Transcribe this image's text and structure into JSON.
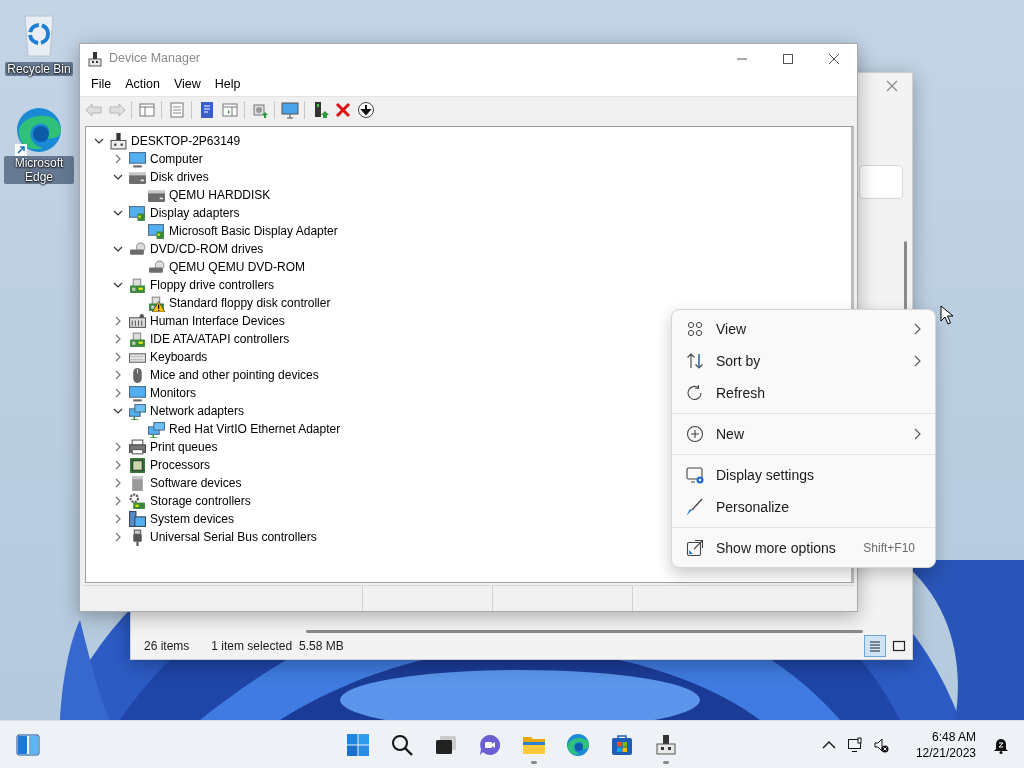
{
  "desktop_icons": [
    {
      "kind": "recycle-bin",
      "label": "Recycle Bin"
    },
    {
      "kind": "edge",
      "label": "Microsoft Edge"
    }
  ],
  "explorer_window": {
    "status_bar": {
      "item_count": "26 items",
      "selection": "1 item selected",
      "size": "5.58 MB"
    },
    "view_buttons": [
      {
        "kind": "details",
        "selected": true
      },
      {
        "kind": "tiles",
        "selected": false
      }
    ]
  },
  "device_manager": {
    "title": "Device Manager",
    "menu": [
      "File",
      "Action",
      "View",
      "Help"
    ],
    "toolbar": [
      {
        "kind": "back",
        "disabled": true
      },
      {
        "kind": "forward",
        "disabled": true
      },
      {
        "kind": "separator"
      },
      {
        "kind": "console-tree",
        "disabled": false
      },
      {
        "kind": "separator"
      },
      {
        "kind": "properties",
        "disabled": false
      },
      {
        "kind": "separator"
      },
      {
        "kind": "help",
        "disabled": false
      },
      {
        "kind": "action-pane",
        "disabled": false
      },
      {
        "kind": "separator"
      },
      {
        "kind": "scan",
        "disabled": false
      },
      {
        "kind": "separator"
      },
      {
        "kind": "monitor",
        "disabled": false
      },
      {
        "kind": "separator"
      },
      {
        "kind": "update",
        "disabled": false
      },
      {
        "kind": "uninstall",
        "disabled": false
      },
      {
        "kind": "disable",
        "disabled": false
      }
    ],
    "tree": {
      "label": "DESKTOP-2P63149",
      "kind": "computer",
      "expanded": true,
      "warning": false,
      "children": [
        {
          "label": "Computer",
          "kind": "monitor",
          "expanded": false,
          "warning": false
        },
        {
          "label": "Disk drives",
          "kind": "disk",
          "expanded": true,
          "warning": false,
          "children": [
            {
              "label": "QEMU HARDDISK",
              "kind": "disk",
              "warning": false
            }
          ]
        },
        {
          "label": "Display adapters",
          "kind": "display",
          "expanded": true,
          "warning": false,
          "children": [
            {
              "label": "Microsoft Basic Display Adapter",
              "kind": "display",
              "warning": false
            }
          ]
        },
        {
          "label": "DVD/CD-ROM drives",
          "kind": "dvd",
          "expanded": true,
          "warning": false,
          "children": [
            {
              "label": "QEMU QEMU DVD-ROM",
              "kind": "dvd",
              "warning": false
            }
          ]
        },
        {
          "label": "Floppy drive controllers",
          "kind": "board",
          "expanded": true,
          "warning": false,
          "children": [
            {
              "label": "Standard floppy disk controller",
              "kind": "board",
              "warning": true
            }
          ]
        },
        {
          "label": "Human Interface Devices",
          "kind": "hid",
          "expanded": false,
          "warning": false
        },
        {
          "label": "IDE ATA/ATAPI controllers",
          "kind": "board",
          "expanded": false,
          "warning": false
        },
        {
          "label": "Keyboards",
          "kind": "keyboard",
          "expanded": false,
          "warning": false
        },
        {
          "label": "Mice and other pointing devices",
          "kind": "mouse",
          "expanded": false,
          "warning": false
        },
        {
          "label": "Monitors",
          "kind": "monitor",
          "expanded": false,
          "warning": false
        },
        {
          "label": "Network adapters",
          "kind": "network",
          "expanded": true,
          "warning": false,
          "children": [
            {
              "label": "Red Hat VirtIO Ethernet Adapter",
              "kind": "network",
              "warning": false
            }
          ]
        },
        {
          "label": "Print queues",
          "kind": "printer",
          "expanded": false,
          "warning": false
        },
        {
          "label": "Processors",
          "kind": "processor",
          "expanded": false,
          "warning": false
        },
        {
          "label": "Software devices",
          "kind": "software",
          "expanded": false,
          "warning": false
        },
        {
          "label": "Storage controllers",
          "kind": "storage",
          "expanded": false,
          "warning": false
        },
        {
          "label": "System devices",
          "kind": "system",
          "expanded": false,
          "warning": false
        },
        {
          "label": "Universal Serial Bus controllers",
          "kind": "usb",
          "expanded": false,
          "warning": false
        }
      ]
    }
  },
  "context_menu": {
    "items": [
      {
        "kind": "view",
        "label": "View",
        "submenu": true
      },
      {
        "kind": "sort",
        "label": "Sort by",
        "submenu": true
      },
      {
        "kind": "refresh",
        "label": "Refresh",
        "submenu": false
      },
      {
        "kind": "separator"
      },
      {
        "kind": "new",
        "label": "New",
        "submenu": true
      },
      {
        "kind": "separator"
      },
      {
        "kind": "display",
        "label": "Display settings",
        "submenu": false
      },
      {
        "kind": "personalize",
        "label": "Personalize",
        "submenu": false
      },
      {
        "kind": "separator"
      },
      {
        "kind": "more",
        "label": "Show more options",
        "submenu": false,
        "shortcut": "Shift+F10"
      }
    ]
  },
  "taskbar": {
    "widgets": {
      "kind": "widgets"
    },
    "apps": [
      {
        "kind": "start",
        "running": false
      },
      {
        "kind": "search",
        "running": false
      },
      {
        "kind": "task-view",
        "running": false
      },
      {
        "kind": "chat",
        "running": false
      },
      {
        "kind": "file-explorer",
        "running": true
      },
      {
        "kind": "edge",
        "running": false
      },
      {
        "kind": "store",
        "running": false
      },
      {
        "kind": "device-manager",
        "running": true
      }
    ],
    "tray": [
      {
        "kind": "chevron"
      },
      {
        "kind": "network"
      },
      {
        "kind": "volume-muted"
      }
    ],
    "clock": {
      "time": "6:48 AM",
      "date": "12/21/2023"
    },
    "notification": {
      "kind": "do-not-disturb"
    }
  }
}
